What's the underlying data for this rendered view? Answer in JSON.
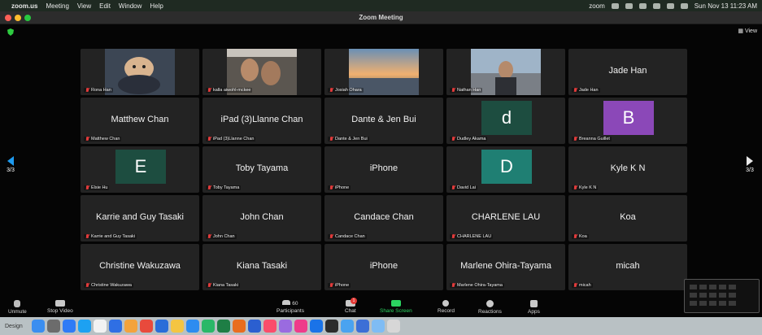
{
  "menubar": {
    "app": "zoom.us",
    "items": [
      "Meeting",
      "View",
      "Edit",
      "Window",
      "Help"
    ],
    "right_brand": "zoom",
    "clock": "Sun Nov 13 11:23 AM"
  },
  "window": {
    "title": "Zoom Meeting"
  },
  "view_button": "View",
  "pager": {
    "left": "3/3",
    "right": "3/3"
  },
  "participants": [
    {
      "center": "",
      "label": "Rona Han",
      "photo": "dog"
    },
    {
      "center": "",
      "label": "kalla aiwohl-mckee",
      "photo": "selfie"
    },
    {
      "center": "",
      "label": "Josiah Ohara",
      "photo": "sunset"
    },
    {
      "center": "",
      "label": "Nathan Han",
      "photo": "street"
    },
    {
      "center": "Jade Han",
      "label": "Jade Han"
    },
    {
      "center": "Matthew Chan",
      "label": "Matthew Chan"
    },
    {
      "center": "iPad (3)Llanne Chan",
      "label": "iPad (3)Llanne Chan"
    },
    {
      "center": "Dante & Jen Bui",
      "label": "Dante & Jen Bui"
    },
    {
      "center": "",
      "label": "Dudley Akama",
      "letter": "d",
      "letter_color": "#1d4d40"
    },
    {
      "center": "",
      "label": "Breanna Guillet",
      "letter": "B",
      "letter_color": "#8b48b8"
    },
    {
      "center": "",
      "label": "Elsie Hu",
      "letter": "E",
      "letter_color": "#1d4d40"
    },
    {
      "center": "Toby Tayama",
      "label": "Toby Tayama"
    },
    {
      "center": "iPhone",
      "label": "iPhone"
    },
    {
      "center": "",
      "label": "David Lai",
      "letter": "D",
      "letter_color": "#1f7f73"
    },
    {
      "center": "Kyle K N",
      "label": "Kyle K N"
    },
    {
      "center": "Karrie and Guy Tasaki",
      "label": "Karrie and Guy Tasaki"
    },
    {
      "center": "John Chan",
      "label": "John Chan"
    },
    {
      "center": "Candace Chan",
      "label": "Candace Chan"
    },
    {
      "center": "CHARLENE LAU",
      "label": "CHARLENE LAU"
    },
    {
      "center": "Koa",
      "label": "Koa"
    },
    {
      "center": "Christine Wakuzawa",
      "label": "Christine Wakuzawa"
    },
    {
      "center": "Kiana Tasaki",
      "label": "Kiana Tasaki"
    },
    {
      "center": "iPhone",
      "label": "iPhone"
    },
    {
      "center": "Marlene Ohira-Tayama",
      "label": "Marlene Ohira-Tayama"
    },
    {
      "center": "micah",
      "label": "micah"
    }
  ],
  "toolbar": {
    "unmute": "Unmute",
    "stop_video": "Stop Video",
    "participants": "Participants",
    "participants_count": "60",
    "chat": "Chat",
    "share": "Share Screen",
    "record": "Record",
    "reactions": "Reactions",
    "apps": "Apps"
  },
  "dock": {
    "label": "Design"
  }
}
